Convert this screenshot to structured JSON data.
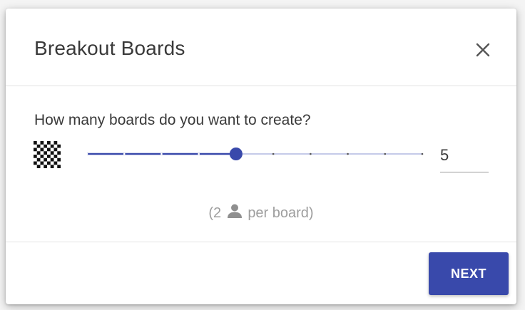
{
  "dialog": {
    "title": "Breakout Boards",
    "close_icon": "close-icon"
  },
  "content": {
    "question": "How many boards do you want to create?",
    "board_icon": "checkerboard-icon",
    "slider": {
      "min": 1,
      "max": 10,
      "value": 5
    },
    "count_value": "5",
    "per_board": {
      "open": "(2",
      "icon": "person-icon",
      "close": "per board)"
    }
  },
  "footer": {
    "next_label": "NEXT"
  },
  "colors": {
    "accent": "#3949ab",
    "text": "#3a3a3a",
    "muted": "#9e9e9e",
    "slider_inactive": "#c5cae9"
  }
}
